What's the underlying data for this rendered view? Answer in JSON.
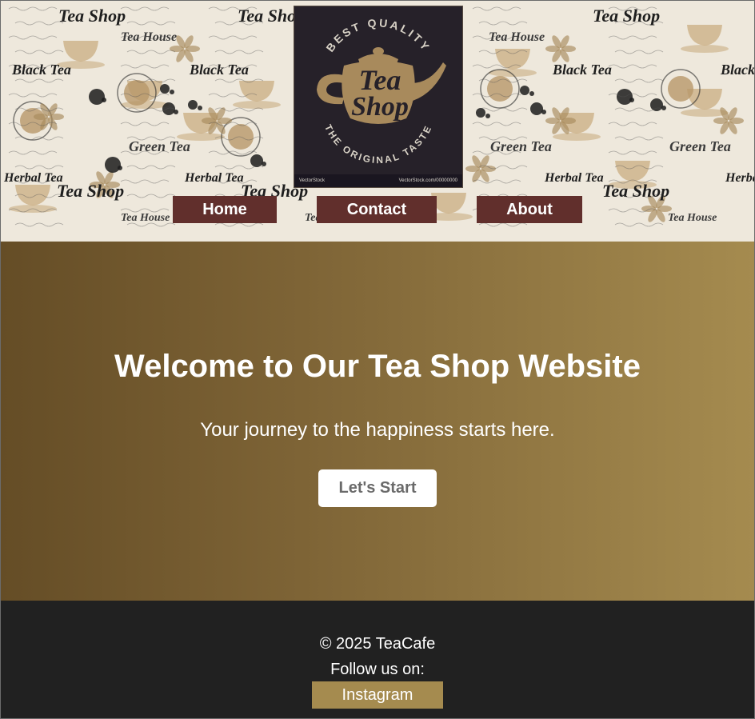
{
  "header": {
    "logo": {
      "top_arc": "BEST QUALITY",
      "line1": "Tea",
      "line2": "Shop",
      "bottom_arc": "THE ORIGINAL TASTE",
      "credit_left": "VectorStock",
      "credit_right": "VectorStock.com/00000000"
    },
    "background_words": [
      "Tea Shop",
      "Black Tea",
      "Green Tea",
      "Herbal Tea",
      "Tea House"
    ]
  },
  "nav": {
    "home": "Home",
    "contact": "Contact",
    "about": "About"
  },
  "hero": {
    "title": "Welcome to Our Tea Shop Website",
    "subtitle": "Your journey to the happiness starts here.",
    "cta": "Let's Start"
  },
  "footer": {
    "copyright": "© 2025 TeaCafe",
    "follow": "Follow us on:",
    "instagram": "Instagram"
  },
  "colors": {
    "nav_bg": "#612f2c",
    "hero_start": "#654d26",
    "hero_end": "#a58b4f",
    "footer_bg": "#212121",
    "instagram_bg": "#a58b4f",
    "logo_bg": "#262129",
    "logo_gold": "#a88a5c"
  }
}
